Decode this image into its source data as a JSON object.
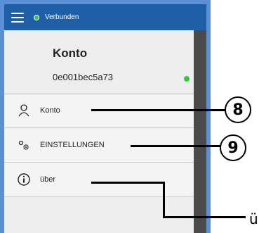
{
  "appbar": {
    "menu_icon": "hamburger-menu-icon",
    "status_text": "Verbunden",
    "status_color": "#2ecc40",
    "bar_color": "#1e5fa8"
  },
  "account": {
    "title": "Konto",
    "id": "0e001bec5a73",
    "online_color": "#2ecc40"
  },
  "menu": [
    {
      "label": "Konto",
      "icon": "person-icon"
    },
    {
      "label": "EINSTELLUNGEN",
      "icon": "gears-icon"
    },
    {
      "label": "über",
      "icon": "info-icon"
    }
  ],
  "callouts": {
    "badge_8": "8",
    "badge_9": "9",
    "ueber_label": "üb"
  }
}
